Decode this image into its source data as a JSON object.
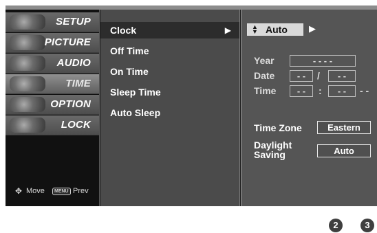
{
  "sidebar": {
    "categories": [
      {
        "label": "SETUP"
      },
      {
        "label": "PICTURE"
      },
      {
        "label": "AUDIO"
      },
      {
        "label": "TIME"
      },
      {
        "label": "OPTION"
      },
      {
        "label": "LOCK"
      }
    ],
    "active_category": "TIME",
    "hint_move": "Move",
    "hint_menu_key": "MENU",
    "hint_prev": "Prev"
  },
  "submenu": {
    "items": [
      {
        "label": "Clock",
        "arrow": "▶"
      },
      {
        "label": "Off Time"
      },
      {
        "label": "On Time"
      },
      {
        "label": "Sleep Time"
      },
      {
        "label": "Auto Sleep"
      }
    ],
    "active_item": "Clock"
  },
  "detail": {
    "clock_mode": "Auto",
    "clock_updown_icon": "▲▼",
    "clock_right_arrow": "▶",
    "year": {
      "label": "Year",
      "value": "- - - -"
    },
    "date": {
      "label": "Date",
      "month": "- -",
      "separator": "/",
      "day": "- -"
    },
    "time": {
      "label": "Time",
      "hour": "- -",
      "separator": ":",
      "minute": "- -",
      "ampm": "- -"
    },
    "time_zone": {
      "label": "Time Zone",
      "value": "Eastern"
    },
    "daylight_saving": {
      "label_line1": "Daylight",
      "label_line2": "Saving",
      "value": "Auto"
    }
  },
  "badges": [
    "2",
    "3"
  ],
  "colors": {
    "osd_background": "#1b1b1b",
    "submenu_background": "#4b4b4b",
    "detail_background": "#555555",
    "text": "#ffffff"
  }
}
